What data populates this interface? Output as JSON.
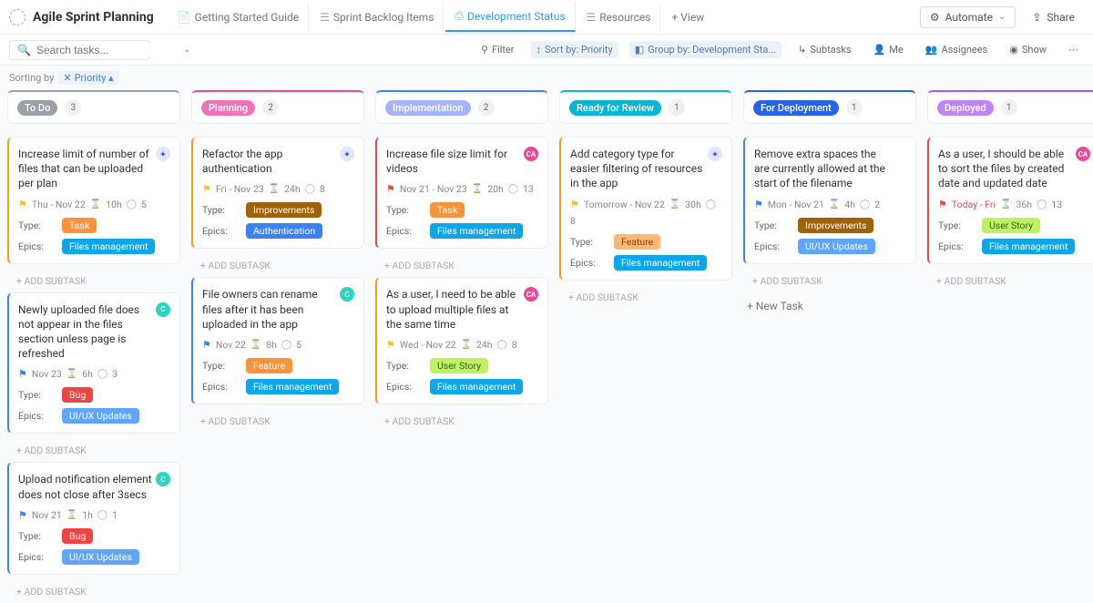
{
  "header": {
    "title": "Agile Sprint Planning",
    "tabs": [
      {
        "label": "Getting Started Guide",
        "icon": "📄"
      },
      {
        "label": "Sprint Backlog Items",
        "icon": "☰"
      },
      {
        "label": "Development Status",
        "icon": "⎙",
        "active": true
      },
      {
        "label": "Resources",
        "icon": "☰"
      }
    ],
    "add_view": "+ View",
    "automate": "Automate",
    "share": "Share"
  },
  "toolbar": {
    "search_placeholder": "Search tasks...",
    "filter": "Filter",
    "sort": "Sort by: Priority",
    "group": "Group by: Development Sta...",
    "subtasks": "Subtasks",
    "me": "Me",
    "assignees": "Assignees",
    "show": "Show"
  },
  "subhead": {
    "label": "Sorting by",
    "chip_icon": "✕",
    "chip": "Priority ▴"
  },
  "columns": [
    {
      "name": "To Do",
      "count": "3",
      "accent": "#9aa0a6",
      "pill": "#9aa0a6",
      "cards": [
        {
          "title": "Increase limit of number of files that can be uploaded per plan",
          "avatar": {
            "bg": "#e0e7ff",
            "text": "✦",
            "color": "#4f46e5"
          },
          "bar": "#f59e0b",
          "flag_color": "#fbbf24",
          "date": "Thu  -  Nov 22",
          "hours": "10h",
          "subs": "5",
          "type": {
            "text": "Task",
            "bg": "#fb923c"
          },
          "epics": {
            "text": "Files management",
            "bg": "#0ea5e9"
          }
        },
        {
          "title": "Newly uploaded file does not appear in the files section unless page is refreshed",
          "avatar": {
            "bg": "#2dd4bf",
            "text": "C"
          },
          "bar": "#3b82f6",
          "flag_color": "#3b82f6",
          "date": "Nov 23",
          "hours": "6h",
          "subs": "3",
          "type": {
            "text": "Bug",
            "bg": "#ef4444"
          },
          "epics": {
            "text": "UI/UX Updates",
            "bg": "#60a5fa"
          }
        },
        {
          "title": "Upload notification element does not close after 3secs",
          "avatar": {
            "bg": "#2dd4bf",
            "text": "C"
          },
          "bar": "#3b82f6",
          "flag_color": "#3b82f6",
          "date": "Nov 21",
          "hours": "1h",
          "subs": "1",
          "type": {
            "text": "Bug",
            "bg": "#ef4444"
          },
          "epics": {
            "text": "UI/UX Updates",
            "bg": "#60a5fa"
          }
        }
      ]
    },
    {
      "name": "Planning",
      "count": "2",
      "accent": "#ec4899",
      "pill": "#f472b6",
      "cards": [
        {
          "title": "Refactor the app authentication",
          "avatar": {
            "bg": "#e0e7ff",
            "text": "✦",
            "color": "#4f46e5"
          },
          "bar": "#f59e0b",
          "flag_color": "#fbbf24",
          "date": "Fri  -  Nov 23",
          "hours": "24h",
          "subs": "8",
          "type": {
            "text": "Improvements",
            "bg": "#a16207"
          },
          "epics": {
            "text": "Authentication",
            "bg": "#3b82f6"
          }
        },
        {
          "title": "File owners can rename files after it has been uploaded in the app",
          "avatar": {
            "bg": "#2dd4bf",
            "text": "C"
          },
          "bar": "#3b82f6",
          "flag_color": "#3b82f6",
          "date": "Nov 22",
          "hours": "8h",
          "subs": "5",
          "type": {
            "text": "Feature",
            "bg": "#fb923c",
            "light": true
          },
          "epics": {
            "text": "Files management",
            "bg": "#0ea5e9"
          }
        }
      ]
    },
    {
      "name": "Implementation",
      "count": "2",
      "accent": "#3b82f6",
      "pill": "#a5b4fc",
      "cards": [
        {
          "title": "Increase file size limit for videos",
          "avatar": {
            "bg": "#ec4899",
            "text": "CA"
          },
          "bar": "#ef4444",
          "flag_color": "#ef4444",
          "date": "Nov 21  -  Nov 23",
          "hours": "20h",
          "subs": "13",
          "type": {
            "text": "Task",
            "bg": "#fb923c"
          },
          "epics": {
            "text": "Files management",
            "bg": "#0ea5e9"
          }
        },
        {
          "title": "As a user, I need to be able to upload multiple files at the same time",
          "avatar": {
            "bg": "#ec4899",
            "text": "CA"
          },
          "bar": "#f59e0b",
          "flag_color": "#fbbf24",
          "date": "Wed  -  Nov 22",
          "hours": "24h",
          "subs": "8",
          "type": {
            "text": "User Story",
            "bg": "#bef264",
            "color": "#3f6212"
          },
          "epics": {
            "text": "Files management",
            "bg": "#0ea5e9"
          }
        }
      ]
    },
    {
      "name": "Ready for Review",
      "count": "1",
      "accent": "#06b6d4",
      "pill": "#06b6d4",
      "cards": [
        {
          "title": "Add category type for easier filtering of resources in the app",
          "avatar": {
            "bg": "#e0e7ff",
            "text": "✦",
            "color": "#4f46e5"
          },
          "bar": "#f59e0b",
          "flag_color": "#fbbf24",
          "date": "Tomorrow  -  Nov 22",
          "hours": "30h",
          "subs": "8",
          "type": {
            "text": "Feature",
            "bg": "#fdba74",
            "color": "#9a3412"
          },
          "epics": {
            "text": "Files management",
            "bg": "#0ea5e9"
          }
        }
      ]
    },
    {
      "name": "For Deployment",
      "count": "1",
      "accent": "#2563eb",
      "pill": "#2563eb",
      "cards": [
        {
          "title": "Remove extra spaces the are currently allowed at the start of the filename",
          "bar": "#3b82f6",
          "flag_color": "#3b82f6",
          "date": "Mon  -  Nov 21",
          "hours": "4h",
          "subs": "2",
          "type": {
            "text": "Improvements",
            "bg": "#a16207"
          },
          "epics": {
            "text": "UI/UX Updates",
            "bg": "#60a5fa"
          }
        }
      ],
      "new_task": "+ New Task"
    },
    {
      "name": "Deployed",
      "count": "1",
      "accent": "#a855f7",
      "pill": "#c084fc",
      "cards": [
        {
          "title": "As a user, I should be able to sort the files by created date and updated date",
          "avatar": {
            "bg": "#ec4899",
            "text": "CA"
          },
          "bar": "#ef4444",
          "flag_color": "#ef4444",
          "date": "Today  -  Fri",
          "date_color": "#ef4444",
          "hours": "36h",
          "subs": "13",
          "type": {
            "text": "User Story",
            "bg": "#bef264",
            "color": "#3f6212"
          },
          "epics": {
            "text": "Files management",
            "bg": "#0ea5e9"
          }
        }
      ]
    }
  ],
  "add_subtask_label": "+ ADD SUBTASK"
}
